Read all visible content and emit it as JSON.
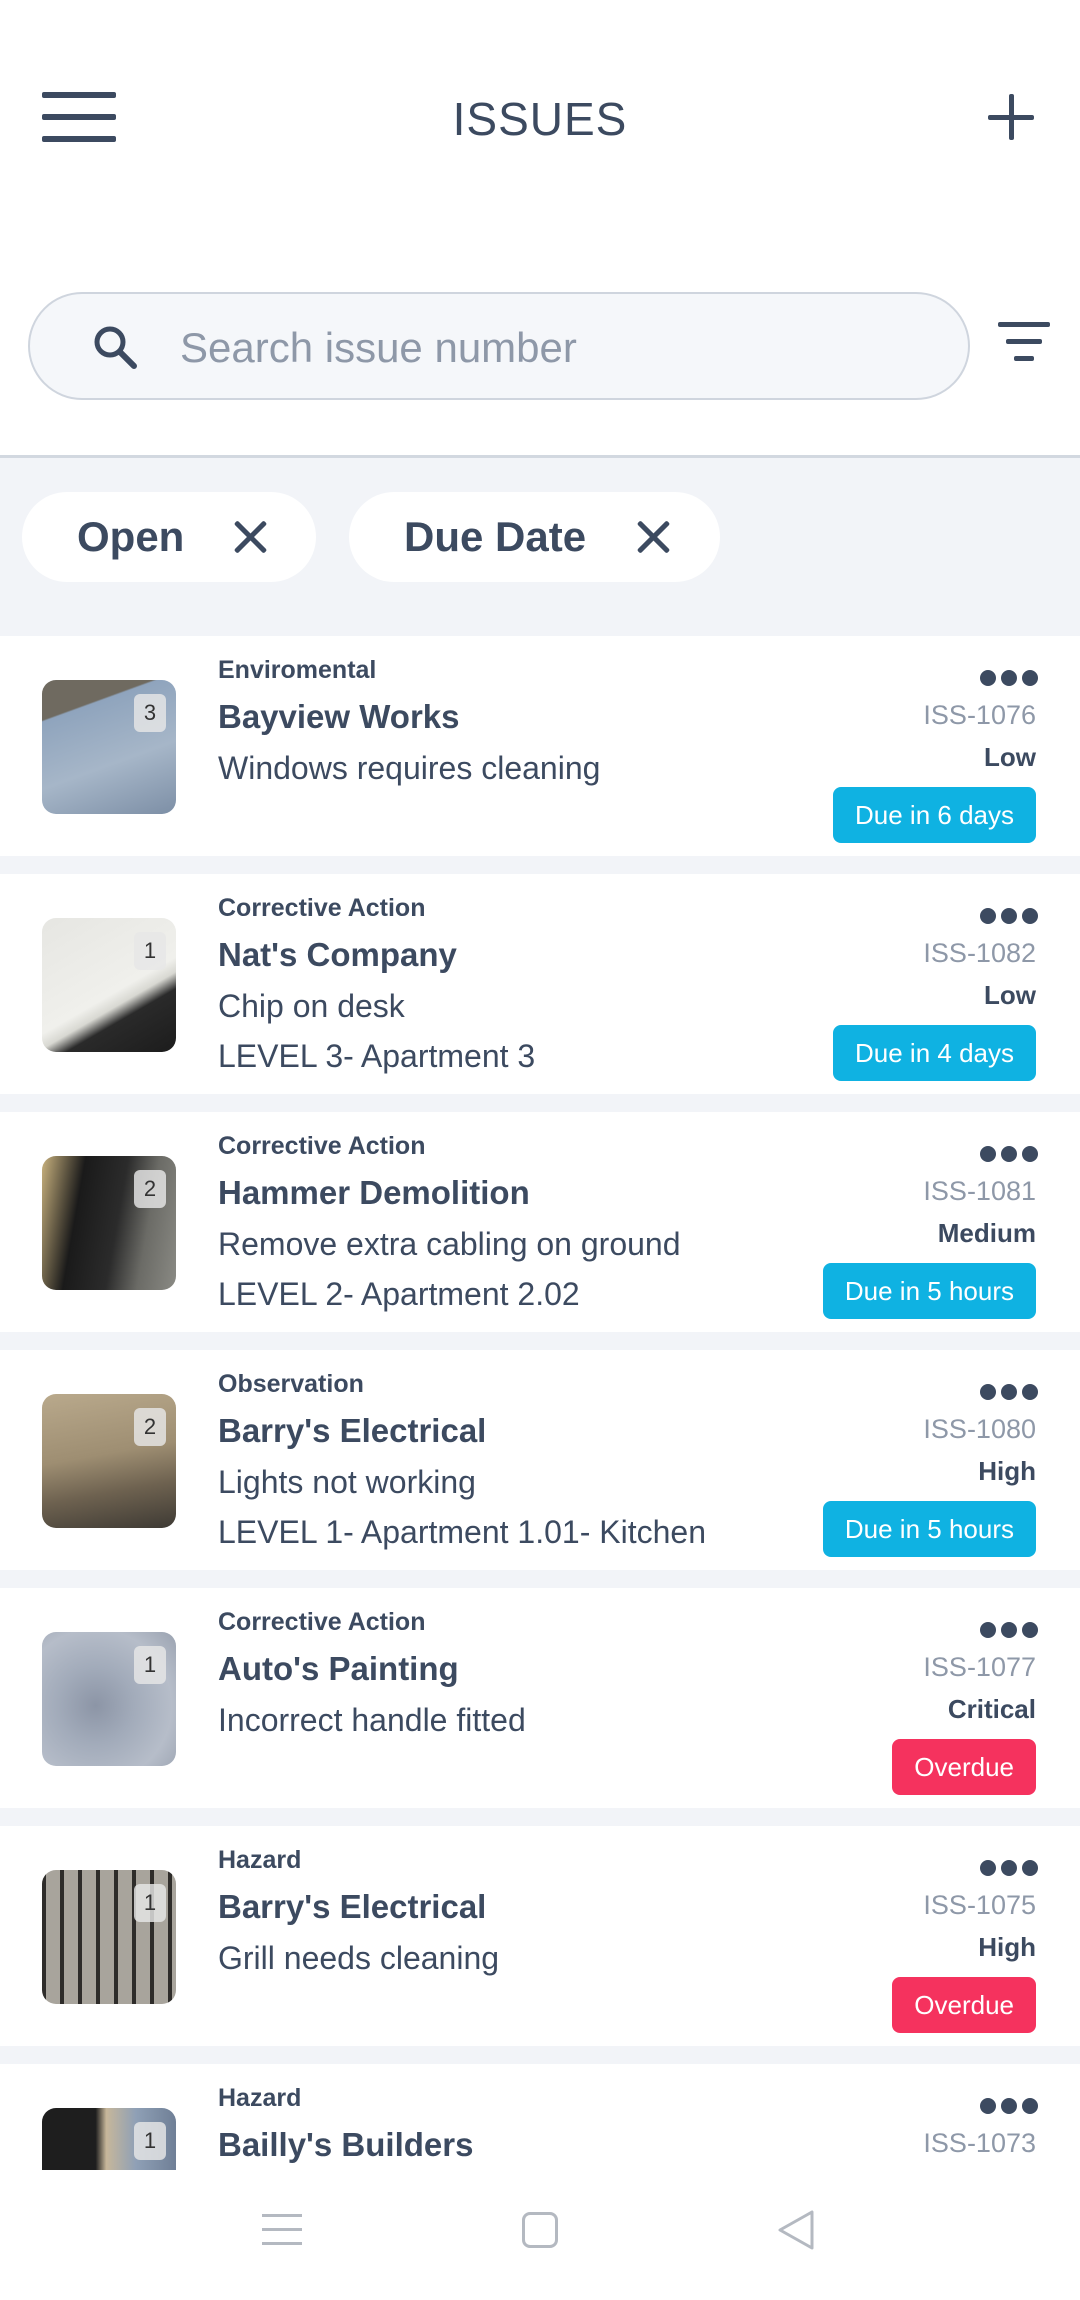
{
  "header": {
    "title": "ISSUES"
  },
  "search": {
    "placeholder": "Search issue number",
    "value": ""
  },
  "filters": [
    {
      "label": "Open"
    },
    {
      "label": "Due Date"
    }
  ],
  "issues": [
    {
      "count": "3",
      "category": "Enviromental",
      "company": "Bayview Works",
      "description": "Windows requires cleaning",
      "location": "",
      "issue_number": "ISS-1076",
      "priority": "Low",
      "due": "Due in 6 days",
      "status": "soon"
    },
    {
      "count": "1",
      "category": "Corrective Action",
      "company": "Nat's Company",
      "description": "Chip on desk",
      "location": "LEVEL 3- Apartment 3",
      "issue_number": "ISS-1082",
      "priority": "Low",
      "due": "Due in 4 days",
      "status": "soon"
    },
    {
      "count": "2",
      "category": "Corrective Action",
      "company": "Hammer Demolition",
      "description": "Remove extra cabling on ground",
      "location": "LEVEL 2- Apartment 2.02",
      "issue_number": "ISS-1081",
      "priority": "Medium",
      "due": "Due in 5 hours",
      "status": "soon"
    },
    {
      "count": "2",
      "category": "Observation",
      "company": "Barry's Electrical",
      "description": "Lights not working",
      "location": "LEVEL 1- Apartment 1.01- Kitchen",
      "issue_number": "ISS-1080",
      "priority": "High",
      "due": "Due in 5 hours",
      "status": "soon"
    },
    {
      "count": "1",
      "category": "Corrective Action",
      "company": "Auto's Painting",
      "description": "Incorrect handle fitted",
      "location": "",
      "issue_number": "ISS-1077",
      "priority": "Critical",
      "due": "Overdue",
      "status": "overdue"
    },
    {
      "count": "1",
      "category": "Hazard",
      "company": "Barry's Electrical",
      "description": "Grill needs cleaning",
      "location": "",
      "issue_number": "ISS-1075",
      "priority": "High",
      "due": "Overdue",
      "status": "overdue"
    },
    {
      "count": "1",
      "category": "Hazard",
      "company": "Bailly's Builders",
      "description": "",
      "location": "",
      "issue_number": "ISS-1073",
      "priority": "",
      "due": "",
      "status": ""
    }
  ],
  "icons": {
    "menu": "hamburger-menu-icon",
    "add": "plus-icon",
    "search": "search-icon",
    "filter": "filter-lines-icon",
    "remove_filter": "close-icon",
    "more": "more-dots-icon",
    "nav_menu": "recent-apps-icon",
    "nav_home": "home-square-icon",
    "nav_back": "back-triangle-icon"
  },
  "colors": {
    "text": "#3c4a60",
    "muted": "#8e98a8",
    "due_soon": "#0fb2e2",
    "overdue": "#f5325e",
    "list_background": "#f2f4f8"
  }
}
